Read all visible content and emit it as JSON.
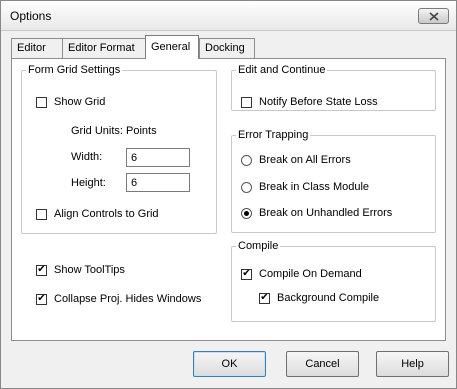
{
  "window": {
    "title": "Options"
  },
  "tabs": [
    "Editor",
    "Editor Format",
    "General",
    "Docking"
  ],
  "form_grid": {
    "legend": "Form Grid Settings",
    "show_grid": {
      "label": "Show Grid",
      "checked": false
    },
    "grid_units": "Grid Units:  Points",
    "width_label": "Width:",
    "width_value": "6",
    "height_label": "Height:",
    "height_value": "6",
    "align_controls": {
      "label": "Align Controls to Grid",
      "checked": false
    }
  },
  "show_tooltips": {
    "label": "Show ToolTips",
    "checked": true
  },
  "collapse_proj": {
    "label": "Collapse Proj. Hides Windows",
    "checked": true
  },
  "edit_continue": {
    "legend": "Edit and Continue",
    "notify": {
      "label": "Notify Before State Loss",
      "checked": false
    }
  },
  "error_trapping": {
    "legend": "Error Trapping",
    "options": [
      "Break on All Errors",
      "Break in Class Module",
      "Break on Unhandled Errors"
    ],
    "selected": "Break on Unhandled Errors"
  },
  "compile": {
    "legend": "Compile",
    "on_demand": {
      "label": "Compile On Demand",
      "checked": true
    },
    "background": {
      "label": "Background Compile",
      "checked": true
    }
  },
  "buttons": {
    "ok": "OK",
    "cancel": "Cancel",
    "help": "Help"
  },
  "check_glyph": "✔"
}
